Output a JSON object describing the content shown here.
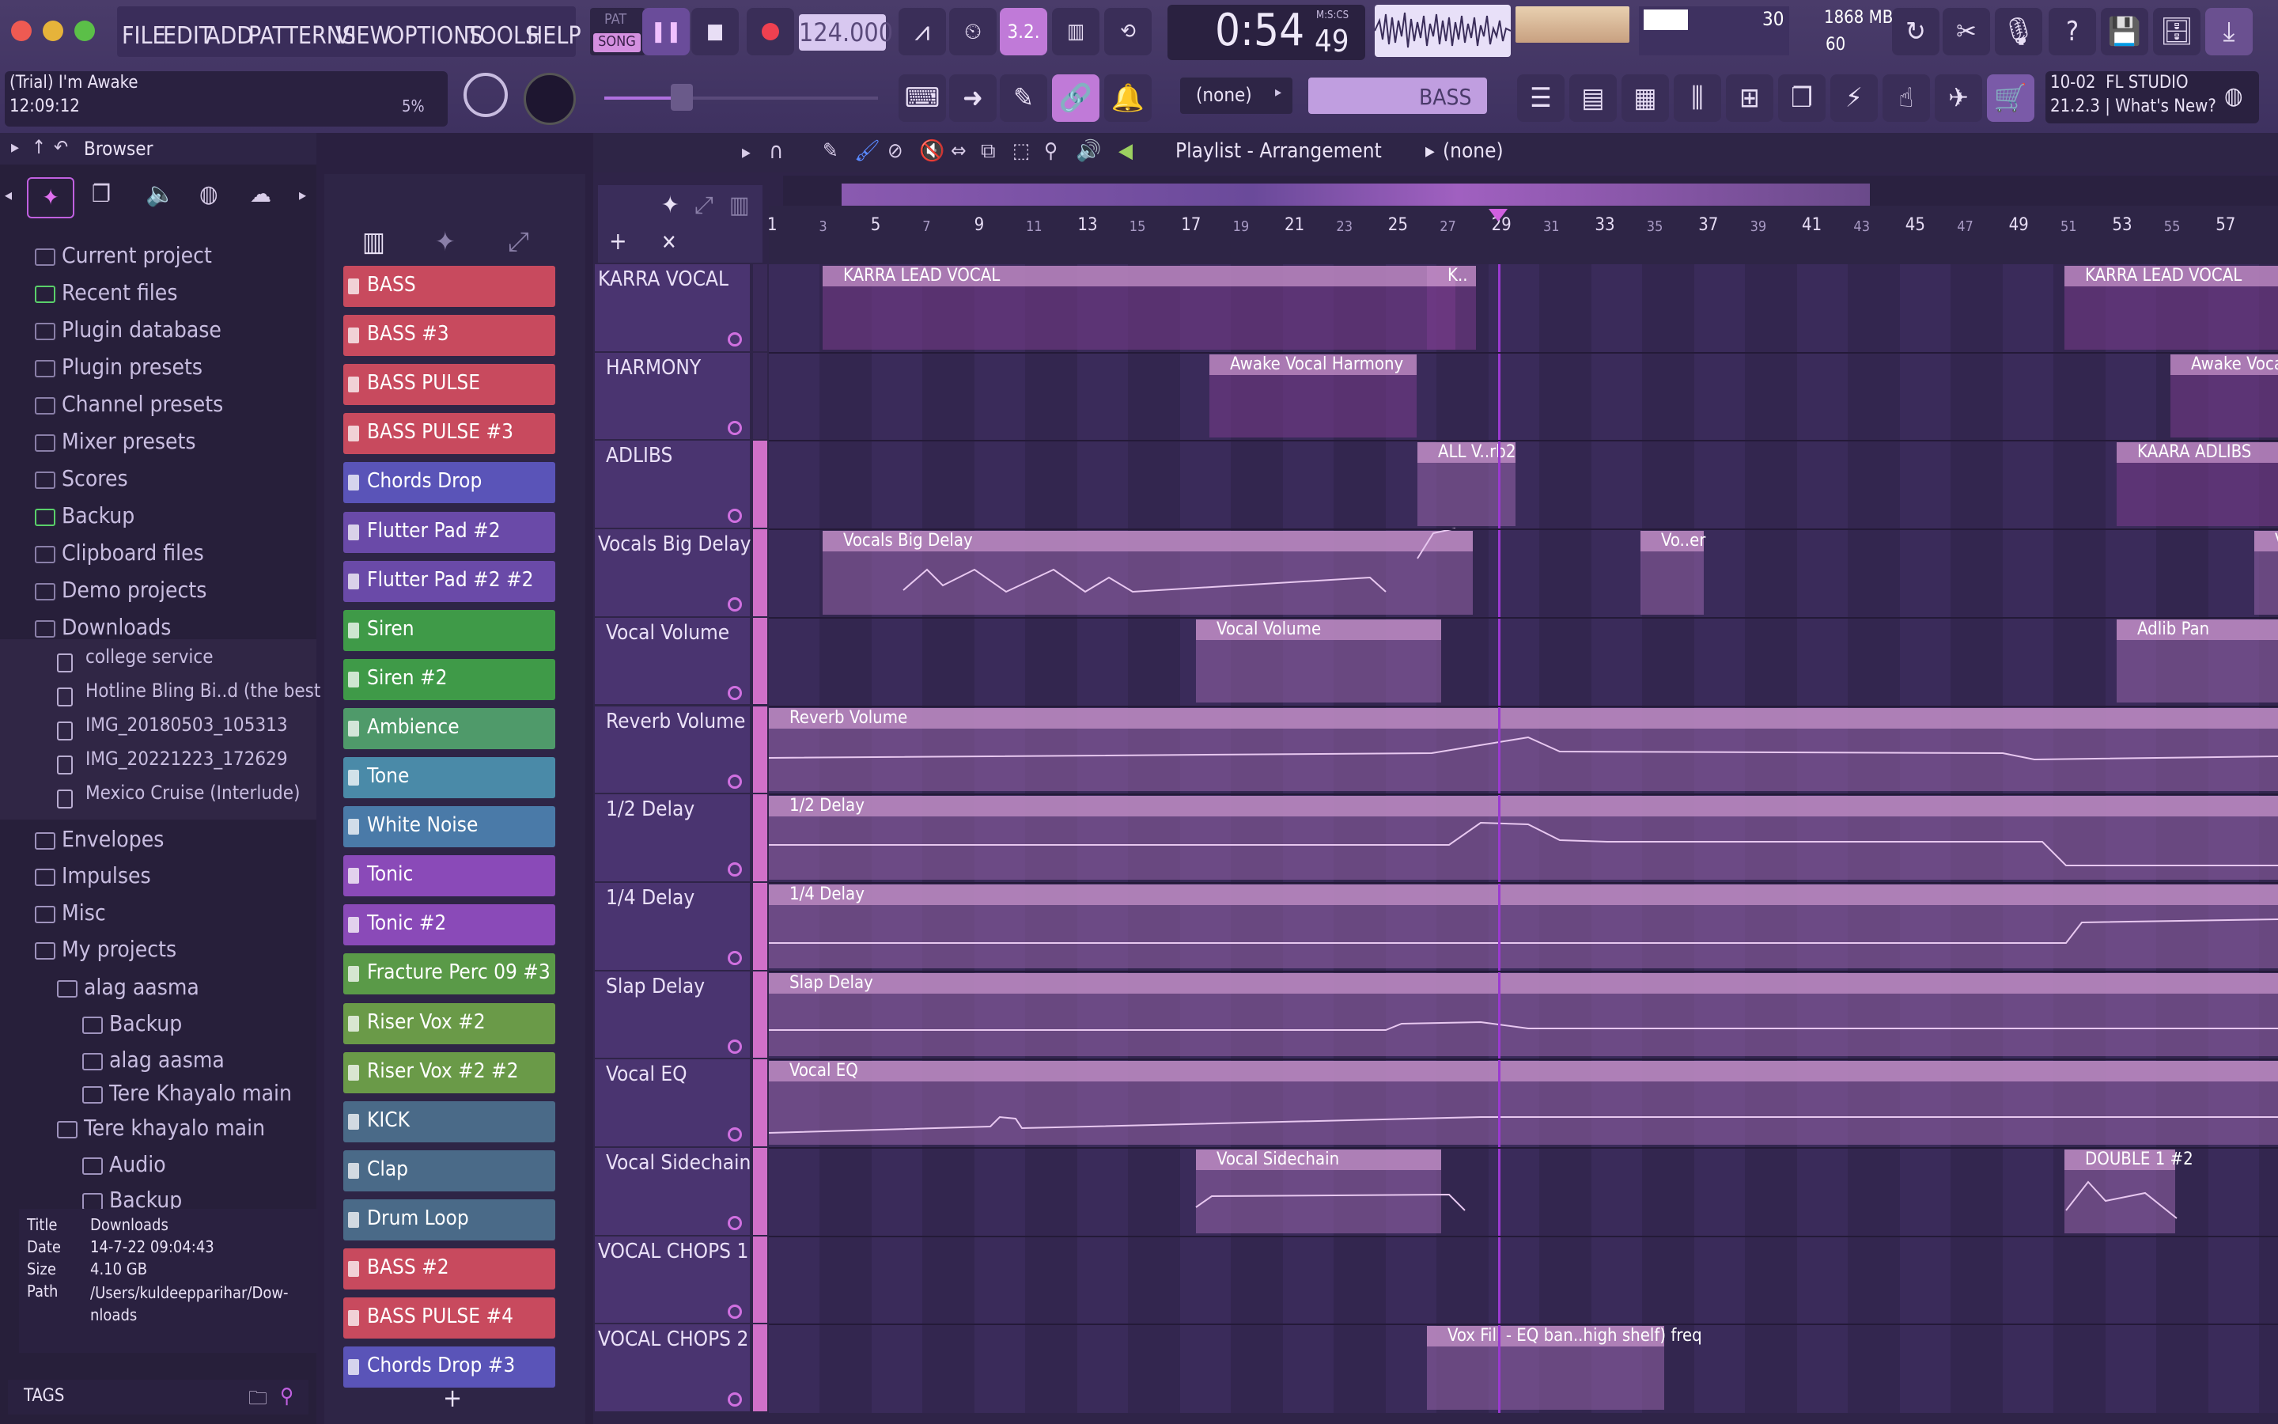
{
  "window": {
    "menu": [
      "FILE",
      "EDIT",
      "ADD",
      "PATTERNS",
      "VIEW",
      "OPTIONS",
      "TOOLS",
      "HELP"
    ]
  },
  "transport": {
    "pat_label": "PAT",
    "song_label": "SONG",
    "tempo": "124.000",
    "time": "0:54",
    "time_frac": "49",
    "time_unit": "M:S:CS",
    "cpu_value": "30",
    "memory": "1868 MB",
    "polyphony": "60",
    "pattern_select": "(none)",
    "channel_name": "BASS"
  },
  "hint": {
    "title": "(Trial) I'm Awake",
    "time": "12:09:12",
    "percent": "5%"
  },
  "news": {
    "line1": "10-02  FL STUDIO",
    "line2": "21.2.3 | What's New?"
  },
  "browser": {
    "title": "Browser",
    "items": [
      {
        "label": "Current project"
      },
      {
        "label": "Recent files"
      },
      {
        "label": "Plugin database"
      },
      {
        "label": "Plugin presets"
      },
      {
        "label": "Channel presets"
      },
      {
        "label": "Mixer presets"
      },
      {
        "label": "Scores"
      },
      {
        "label": "Backup"
      },
      {
        "label": "Clipboard files"
      },
      {
        "label": "Demo projects"
      },
      {
        "label": "Downloads"
      }
    ],
    "downloads": [
      {
        "label": "college service"
      },
      {
        "label": "Hotline Bling Bi..d (the best part)"
      },
      {
        "label": "IMG_20180503_105313"
      },
      {
        "label": "IMG_20221223_172629"
      },
      {
        "label": "Mexico Cruise (Interlude)"
      }
    ],
    "items2": [
      {
        "label": "Envelopes"
      },
      {
        "label": "Impulses"
      },
      {
        "label": "Misc"
      },
      {
        "label": "My projects"
      },
      {
        "label": "alag aasma"
      },
      {
        "label": "Backup"
      },
      {
        "label": "alag aasma"
      },
      {
        "label": "Tere Khayalo main"
      },
      {
        "label": "Tere khayalo main"
      },
      {
        "label": "Audio"
      },
      {
        "label": "Backup"
      }
    ],
    "info": {
      "title_k": "Title",
      "title_v": "Downloads",
      "date_k": "Date",
      "date_v": "14-7-22 09:04:43",
      "size_k": "Size",
      "size_v": "4.10 GB",
      "path_k": "Path",
      "path_v": "/Users/kuldeepparihar/Dow-\nnloads"
    },
    "tags": "TAGS"
  },
  "channels": [
    {
      "name": "BASS",
      "color": "#c84a5e"
    },
    {
      "name": "BASS #3",
      "color": "#c84a5e"
    },
    {
      "name": "BASS PULSE",
      "color": "#c84a5e"
    },
    {
      "name": "BASS PULSE #3",
      "color": "#c84a5e"
    },
    {
      "name": "Chords Drop",
      "color": "#5a54b8"
    },
    {
      "name": "Flutter Pad #2",
      "color": "#6a4aa8"
    },
    {
      "name": "Flutter Pad #2 #2",
      "color": "#6a4aa8"
    },
    {
      "name": "Siren",
      "color": "#3f9a48"
    },
    {
      "name": "Siren #2",
      "color": "#3f9a48"
    },
    {
      "name": "Ambience",
      "color": "#4f9a6a"
    },
    {
      "name": "Tone",
      "color": "#4a8aa8"
    },
    {
      "name": "White Noise",
      "color": "#4a7aa8"
    },
    {
      "name": "Tonic",
      "color": "#8a4ab8"
    },
    {
      "name": "Tonic #2",
      "color": "#8a4ab8"
    },
    {
      "name": "Fracture Perc 09 #3",
      "color": "#5a9a48"
    },
    {
      "name": "Riser Vox #2",
      "color": "#6a9a48"
    },
    {
      "name": "Riser Vox #2 #2",
      "color": "#6a9a48"
    },
    {
      "name": "KICK",
      "color": "#4a6a88"
    },
    {
      "name": "Clap",
      "color": "#4a6a88"
    },
    {
      "name": "Drum Loop",
      "color": "#4a6a88"
    },
    {
      "name": "BASS #2",
      "color": "#c84a5e"
    },
    {
      "name": "BASS PULSE #4",
      "color": "#c84a5e"
    },
    {
      "name": "Chords Drop #3",
      "color": "#5a54b8"
    }
  ],
  "playlist": {
    "title": "Playlist - Arrangement",
    "pattern": "(none)",
    "ruler": [
      "1",
      "3",
      "5",
      "7",
      "9",
      "11",
      "13",
      "15",
      "17",
      "19",
      "21",
      "23",
      "25",
      "27",
      "29",
      "31",
      "33",
      "35",
      "37",
      "39",
      "41",
      "43",
      "45",
      "47",
      "49",
      "51",
      "53",
      "55",
      "57"
    ],
    "tracks": [
      {
        "name": "KARRA VOCAL"
      },
      {
        "name": "HARMONY"
      },
      {
        "name": "ADLIBS"
      },
      {
        "name": "Vocals Big Delay"
      },
      {
        "name": "Vocal Volume"
      },
      {
        "name": "Reverb Volume"
      },
      {
        "name": "1/2 Delay"
      },
      {
        "name": "1/4 Delay"
      },
      {
        "name": "Slap Delay"
      },
      {
        "name": "Vocal EQ"
      },
      {
        "name": "Vocal Sidechain"
      },
      {
        "name": "VOCAL CHOPS 1"
      },
      {
        "name": "VOCAL CHOPS 2"
      }
    ],
    "clips": [
      {
        "label": "KARRA LEAD VOCAL"
      },
      {
        "label": "K.."
      },
      {
        "label": "KARRA LEAD VOCAL"
      },
      {
        "label": "Awake Vocal Harmony"
      },
      {
        "label": "Awake Voca"
      },
      {
        "label": "ALL V..rb2"
      },
      {
        "label": "KAARA ADLIBS"
      },
      {
        "label": "Vocals Big Delay"
      },
      {
        "label": "Vo..er"
      },
      {
        "label": "Vocals Big"
      },
      {
        "label": "Vocal Volume"
      },
      {
        "label": "Adlib Pan"
      },
      {
        "label": "Reverb Volume"
      },
      {
        "label": "1/2 Delay"
      },
      {
        "label": "1/4 Delay"
      },
      {
        "label": "Slap Delay"
      },
      {
        "label": "Vocal EQ"
      },
      {
        "label": "Vocal Sidechain"
      },
      {
        "label": "DOUBLE 1 #2"
      },
      {
        "label": "Vox Fill - EQ ban..high shelf) freq"
      }
    ]
  }
}
